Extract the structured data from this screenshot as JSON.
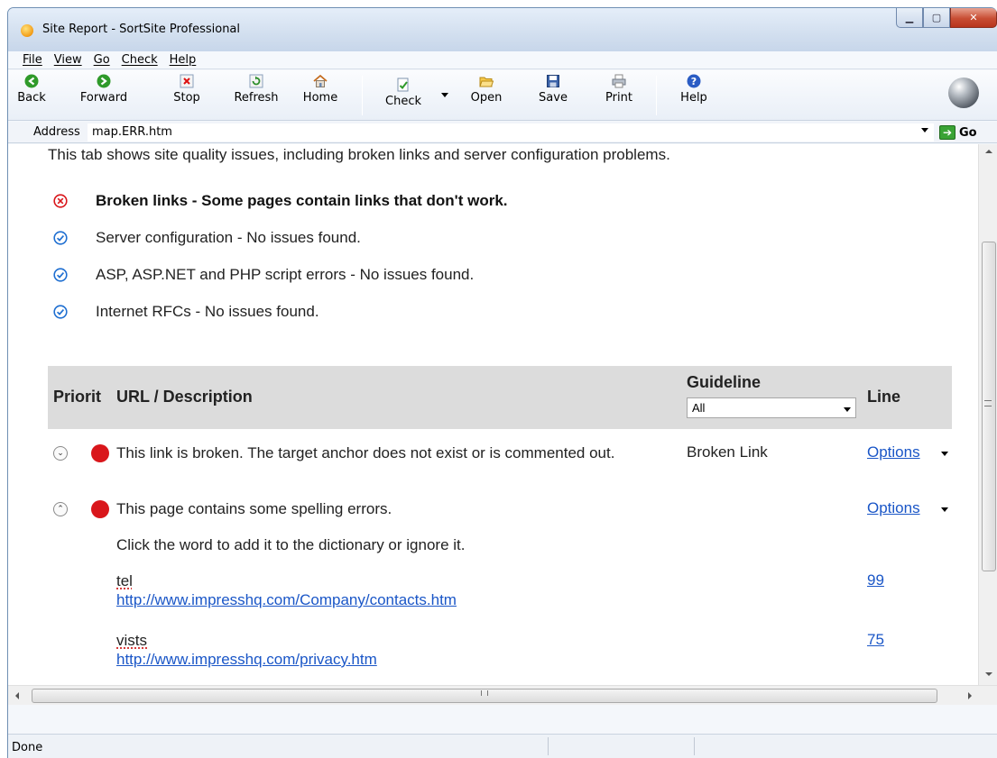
{
  "window": {
    "title": "Site Report - SortSite Professional"
  },
  "menu": {
    "items": [
      "File",
      "View",
      "Go",
      "Check",
      "Help"
    ]
  },
  "toolbar": {
    "back": "Back",
    "forward": "Forward",
    "stop": "Stop",
    "refresh": "Refresh",
    "home": "Home",
    "check": "Check",
    "open": "Open",
    "save": "Save",
    "print": "Print",
    "help": "Help"
  },
  "address": {
    "label": "Address",
    "value": "map.ERR.htm",
    "go": "Go"
  },
  "intro": "This tab shows site quality issues, including broken links and server configuration problems.",
  "checks": [
    {
      "status": "error",
      "text": "Broken links - Some pages contain links that don't work."
    },
    {
      "status": "ok",
      "text": "Server configuration - No issues found."
    },
    {
      "status": "ok",
      "text": "ASP, ASP.NET and PHP script errors - No issues found."
    },
    {
      "status": "ok",
      "text": "Internet RFCs - No issues found."
    }
  ],
  "table": {
    "headers": {
      "priority": "Priorit",
      "url": "URL / Description",
      "guideline": "Guideline",
      "line": "Line"
    },
    "guideline_filter": "All",
    "rows": [
      {
        "description": "This link is broken. The target anchor does not exist or is commented out.",
        "guideline": "Broken Link",
        "options": "Options"
      },
      {
        "description": "This page contains some spelling errors.",
        "guideline": "",
        "options": "Options"
      }
    ],
    "spelling_note": "Click the word to add it to the dictionary or ignore it.",
    "spelling": [
      {
        "word": "tel",
        "url": "http://www.impresshq.com/Company/contacts.htm",
        "line": "99"
      },
      {
        "word": "vists",
        "url": "http://www.impresshq.com/privacy.htm",
        "line": "75"
      }
    ]
  },
  "statusbar": {
    "text": "Done"
  },
  "colors": {
    "error": "#d9161b",
    "ok": "#1f6fd1",
    "link": "#1a56c7"
  }
}
